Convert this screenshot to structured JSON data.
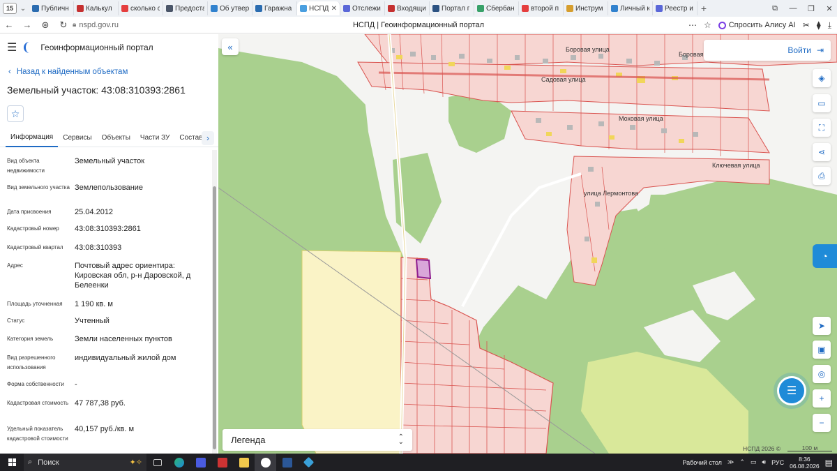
{
  "browser": {
    "tab_counter": "15",
    "tabs": [
      {
        "label": "Публичн",
        "color": "#2b6cb0"
      },
      {
        "label": "Калькул",
        "color": "#c53030"
      },
      {
        "label": "сколько с",
        "color": "#e53e3e"
      },
      {
        "label": "Предоста",
        "color": "#4a5568"
      },
      {
        "label": "Об утвер",
        "color": "#3182ce"
      },
      {
        "label": "Гаражна",
        "color": "#2b6cb0"
      },
      {
        "label": "НСПД",
        "color": "#4a9fe0",
        "active": true
      },
      {
        "label": "Отслежи",
        "color": "#5a67d8"
      },
      {
        "label": "Входящи",
        "color": "#c53030"
      },
      {
        "label": "Портал г",
        "color": "#2c5282"
      },
      {
        "label": "Сбербан",
        "color": "#38a169"
      },
      {
        "label": "второй п",
        "color": "#e53e3e"
      },
      {
        "label": "Инструм",
        "color": "#d69e2e"
      },
      {
        "label": "Личный к",
        "color": "#3182ce"
      },
      {
        "label": "Реестр и",
        "color": "#5a67d8"
      }
    ],
    "url": "nspd.gov.ru",
    "page_title": "НСПД | Геоинформационный портал",
    "alice_label": "Спросить Алису AI"
  },
  "panel": {
    "portal_name": "Геоинформационный портал",
    "back_link": "Назад к найденным объектам",
    "object_title": "Земельный участок: 43:08:310393:2861",
    "tabs": [
      "Информация",
      "Сервисы",
      "Объекты",
      "Части ЗУ",
      "Состав"
    ],
    "properties": [
      {
        "key": "Вид объекта недвижимости",
        "value": "Земельный участок"
      },
      {
        "key": "Вид земельного участка",
        "value": "Землепользование"
      },
      {
        "key": "Дата присвоения",
        "value": "25.04.2012"
      },
      {
        "key": "Кадастровый номер",
        "value": "43:08:310393:2861"
      },
      {
        "key": "Кадастровый квартал",
        "value": "43:08:310393"
      },
      {
        "key": "Адрес",
        "value": "Почтовый адрес ориентира: Кировская обл, р-н Даровской, д Белеенки"
      },
      {
        "key": "Площадь уточненная",
        "value": "1 190 кв. м"
      },
      {
        "key": "Статус",
        "value": "Учтенный"
      },
      {
        "key": "Категория земель",
        "value": "Земли населенных пунктов"
      },
      {
        "key": "Вид разрешенного использования",
        "value": "индивидуальный жилой дом"
      },
      {
        "key": "Форма собственности",
        "value": "-"
      },
      {
        "key": "Кадастровая стоимость",
        "value": "47 787,38 руб."
      },
      {
        "key": "Удельный показатель кадастровой стоимости",
        "value": "40,157 руб./кв. м"
      }
    ]
  },
  "map": {
    "login_label": "Войти",
    "streets": [
      "Боровая улица",
      "Боровая",
      "Садовая улица",
      "Моховая улица",
      "Ключевая улица",
      "улица Лермонтова"
    ],
    "legend_label": "Легенда",
    "copyright": "НСПД 2026 ©",
    "scale_label": "100 м"
  },
  "taskbar": {
    "search_label": "Поиск",
    "desktop_label": "Рабочий стол",
    "lang": "РУС",
    "time": "8:36",
    "date": "06.08.2026"
  }
}
